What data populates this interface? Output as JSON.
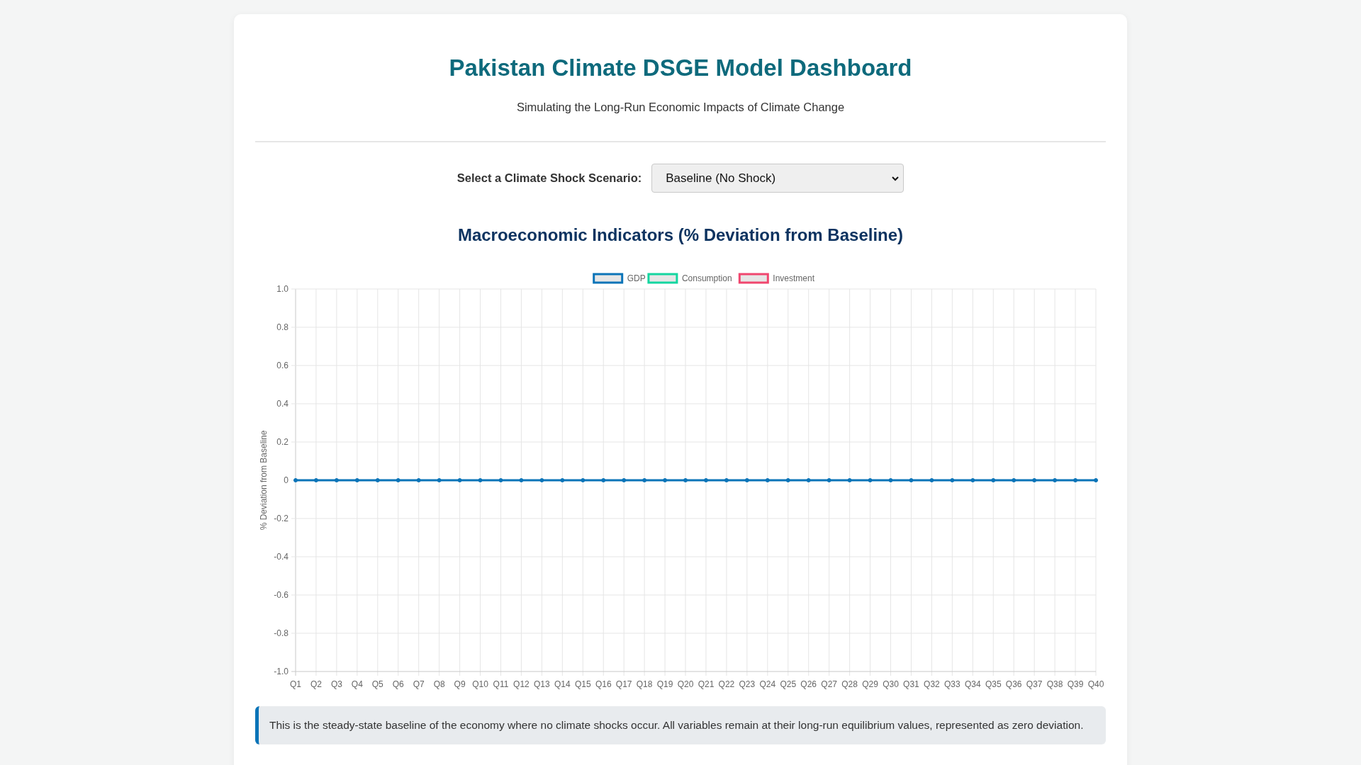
{
  "header": {
    "title": "Pakistan Climate DSGE Model Dashboard",
    "subtitle": "Simulating the Long-Run Economic Impacts of Climate Change"
  },
  "scenario": {
    "label": "Select a Climate Shock Scenario:",
    "value": "Baseline (No Shock)"
  },
  "chart_section": {
    "title": "Macroeconomic Indicators (% Deviation from Baseline)",
    "chart_data": {
      "type": "line",
      "ylabel": "% Deviation from Baseline",
      "categories": [
        "Q1",
        "Q2",
        "Q3",
        "Q4",
        "Q5",
        "Q6",
        "Q7",
        "Q8",
        "Q9",
        "Q10",
        "Q11",
        "Q12",
        "Q13",
        "Q14",
        "Q15",
        "Q16",
        "Q17",
        "Q18",
        "Q19",
        "Q20",
        "Q21",
        "Q22",
        "Q23",
        "Q24",
        "Q25",
        "Q26",
        "Q27",
        "Q28",
        "Q29",
        "Q30",
        "Q31",
        "Q32",
        "Q33",
        "Q34",
        "Q35",
        "Q36",
        "Q37",
        "Q38",
        "Q39",
        "Q40"
      ],
      "series": [
        {
          "name": "GDP",
          "color": "#0b74b8",
          "marker": "circle",
          "values": [
            0,
            0,
            0,
            0,
            0,
            0,
            0,
            0,
            0,
            0,
            0,
            0,
            0,
            0,
            0,
            0,
            0,
            0,
            0,
            0,
            0,
            0,
            0,
            0,
            0,
            0,
            0,
            0,
            0,
            0,
            0,
            0,
            0,
            0,
            0,
            0,
            0,
            0,
            0,
            0
          ]
        },
        {
          "name": "Consumption",
          "color": "#14d6a0",
          "values": [
            null,
            null,
            null,
            null,
            null,
            null,
            null,
            null,
            null,
            null,
            null,
            null,
            null,
            null,
            null,
            null,
            null,
            null,
            null,
            null,
            null,
            null,
            null,
            null,
            null,
            null,
            null,
            null,
            null,
            null,
            null,
            null,
            null,
            null,
            null,
            null,
            null,
            null,
            null,
            null
          ]
        },
        {
          "name": "Investment",
          "color": "#f0466e",
          "values": [
            null,
            null,
            null,
            null,
            null,
            null,
            null,
            null,
            null,
            null,
            null,
            null,
            null,
            null,
            null,
            null,
            null,
            null,
            null,
            null,
            null,
            null,
            null,
            null,
            null,
            null,
            null,
            null,
            null,
            null,
            null,
            null,
            null,
            null,
            null,
            null,
            null,
            null,
            null,
            null
          ]
        }
      ],
      "grid": true,
      "legend": true,
      "ylim": [
        -1,
        1
      ],
      "yticks": [
        {
          "value": 1,
          "label": "1.0"
        },
        {
          "value": 0.8,
          "label": "0.8"
        },
        {
          "value": 0.6,
          "label": "0.6"
        },
        {
          "value": 0.4,
          "label": "0.4"
        },
        {
          "value": 0.2,
          "label": "0.2"
        },
        {
          "value": 0,
          "label": "0"
        },
        {
          "value": -0.2,
          "label": "-0.2"
        },
        {
          "value": -0.4,
          "label": "-0.4"
        },
        {
          "value": -0.6,
          "label": "-0.6"
        },
        {
          "value": -0.8,
          "label": "-0.8"
        },
        {
          "value": -1,
          "label": "-1.0"
        }
      ]
    }
  },
  "description": "This is the steady-state baseline of the economy where no climate shocks occur. All variables remain at their long-run equilibrium values, represented as zero deviation."
}
